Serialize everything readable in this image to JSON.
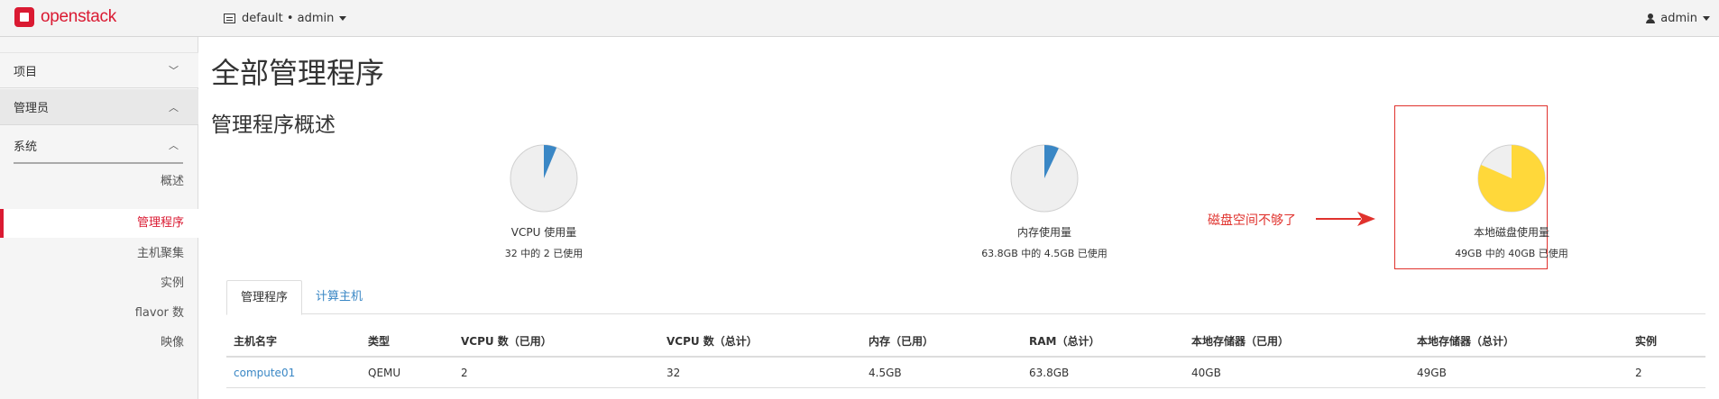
{
  "app": {
    "brand": "openstack",
    "project_selector": "default • admin",
    "user": "admin"
  },
  "sidebar": {
    "sections": [
      {
        "label": "项目",
        "expanded": false
      },
      {
        "label": "管理员",
        "expanded": true
      },
      {
        "label": "系统",
        "expanded": true
      }
    ],
    "items": [
      {
        "label": "概述",
        "active": false
      },
      {
        "label": "管理程序",
        "active": true
      },
      {
        "label": "主机聚集",
        "active": false
      },
      {
        "label": "实例",
        "active": false
      },
      {
        "label": "flavor 数",
        "active": false
      },
      {
        "label": "映像",
        "active": false
      }
    ]
  },
  "main": {
    "title": "全部管理程序",
    "subtitle": "管理程序概述",
    "charts": [
      {
        "label": "VCPU 使用量",
        "detail": "32 中的 2 已使用",
        "used": 2,
        "total": 32,
        "color": "#3a87c5"
      },
      {
        "label": "内存使用量",
        "detail": "63.8GB 中的 4.5GB 已使用",
        "used": 4.5,
        "total": 63.8,
        "color": "#3a87c5"
      },
      {
        "label": "本地磁盘使用量",
        "detail": "49GB 中的 40GB 已使用",
        "used": 40,
        "total": 49,
        "color": "#ffd83a"
      }
    ],
    "annotation": "磁盘空间不够了",
    "annotation_color": "#e0322d",
    "tabs": [
      {
        "label": "管理程序",
        "active": true
      },
      {
        "label": "计算主机",
        "active": false
      }
    ],
    "table": {
      "columns": [
        "主机名字",
        "类型",
        "VCPU 数（已用）",
        "VCPU 数（总计）",
        "内存（已用）",
        "RAM（总计）",
        "本地存储器（已用）",
        "本地存储器（总计）",
        "实例"
      ],
      "rows": [
        [
          "compute01",
          "QEMU",
          "2",
          "32",
          "4.5GB",
          "63.8GB",
          "40GB",
          "49GB",
          "2"
        ]
      ]
    }
  },
  "colors": {
    "brand": "#da1a32",
    "link": "#3a87c5",
    "pie_empty": "#efefef"
  }
}
